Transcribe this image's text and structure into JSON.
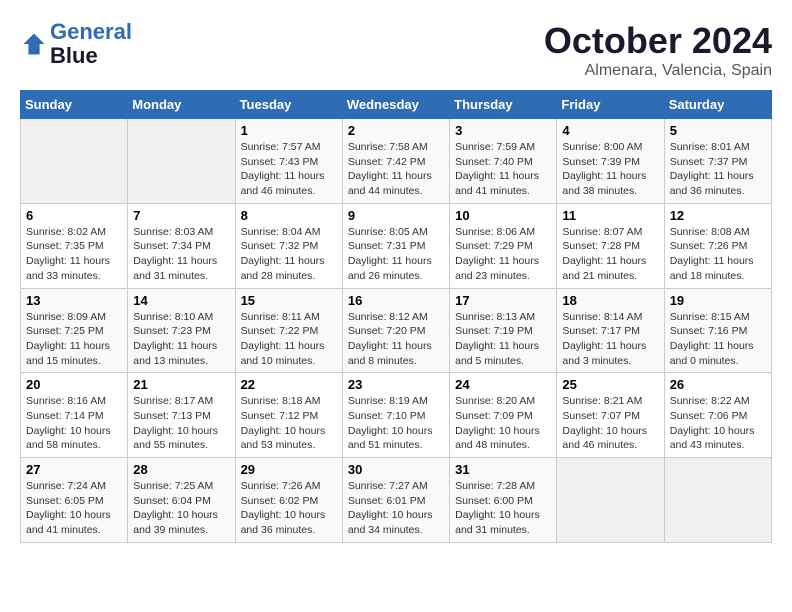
{
  "header": {
    "logo_line1": "General",
    "logo_line2": "Blue",
    "month": "October 2024",
    "location": "Almenara, Valencia, Spain"
  },
  "weekdays": [
    "Sunday",
    "Monday",
    "Tuesday",
    "Wednesday",
    "Thursday",
    "Friday",
    "Saturday"
  ],
  "weeks": [
    [
      {
        "day": "",
        "info": ""
      },
      {
        "day": "",
        "info": ""
      },
      {
        "day": "1",
        "info": "Sunrise: 7:57 AM\nSunset: 7:43 PM\nDaylight: 11 hours and 46 minutes."
      },
      {
        "day": "2",
        "info": "Sunrise: 7:58 AM\nSunset: 7:42 PM\nDaylight: 11 hours and 44 minutes."
      },
      {
        "day": "3",
        "info": "Sunrise: 7:59 AM\nSunset: 7:40 PM\nDaylight: 11 hours and 41 minutes."
      },
      {
        "day": "4",
        "info": "Sunrise: 8:00 AM\nSunset: 7:39 PM\nDaylight: 11 hours and 38 minutes."
      },
      {
        "day": "5",
        "info": "Sunrise: 8:01 AM\nSunset: 7:37 PM\nDaylight: 11 hours and 36 minutes."
      }
    ],
    [
      {
        "day": "6",
        "info": "Sunrise: 8:02 AM\nSunset: 7:35 PM\nDaylight: 11 hours and 33 minutes."
      },
      {
        "day": "7",
        "info": "Sunrise: 8:03 AM\nSunset: 7:34 PM\nDaylight: 11 hours and 31 minutes."
      },
      {
        "day": "8",
        "info": "Sunrise: 8:04 AM\nSunset: 7:32 PM\nDaylight: 11 hours and 28 minutes."
      },
      {
        "day": "9",
        "info": "Sunrise: 8:05 AM\nSunset: 7:31 PM\nDaylight: 11 hours and 26 minutes."
      },
      {
        "day": "10",
        "info": "Sunrise: 8:06 AM\nSunset: 7:29 PM\nDaylight: 11 hours and 23 minutes."
      },
      {
        "day": "11",
        "info": "Sunrise: 8:07 AM\nSunset: 7:28 PM\nDaylight: 11 hours and 21 minutes."
      },
      {
        "day": "12",
        "info": "Sunrise: 8:08 AM\nSunset: 7:26 PM\nDaylight: 11 hours and 18 minutes."
      }
    ],
    [
      {
        "day": "13",
        "info": "Sunrise: 8:09 AM\nSunset: 7:25 PM\nDaylight: 11 hours and 15 minutes."
      },
      {
        "day": "14",
        "info": "Sunrise: 8:10 AM\nSunset: 7:23 PM\nDaylight: 11 hours and 13 minutes."
      },
      {
        "day": "15",
        "info": "Sunrise: 8:11 AM\nSunset: 7:22 PM\nDaylight: 11 hours and 10 minutes."
      },
      {
        "day": "16",
        "info": "Sunrise: 8:12 AM\nSunset: 7:20 PM\nDaylight: 11 hours and 8 minutes."
      },
      {
        "day": "17",
        "info": "Sunrise: 8:13 AM\nSunset: 7:19 PM\nDaylight: 11 hours and 5 minutes."
      },
      {
        "day": "18",
        "info": "Sunrise: 8:14 AM\nSunset: 7:17 PM\nDaylight: 11 hours and 3 minutes."
      },
      {
        "day": "19",
        "info": "Sunrise: 8:15 AM\nSunset: 7:16 PM\nDaylight: 11 hours and 0 minutes."
      }
    ],
    [
      {
        "day": "20",
        "info": "Sunrise: 8:16 AM\nSunset: 7:14 PM\nDaylight: 10 hours and 58 minutes."
      },
      {
        "day": "21",
        "info": "Sunrise: 8:17 AM\nSunset: 7:13 PM\nDaylight: 10 hours and 55 minutes."
      },
      {
        "day": "22",
        "info": "Sunrise: 8:18 AM\nSunset: 7:12 PM\nDaylight: 10 hours and 53 minutes."
      },
      {
        "day": "23",
        "info": "Sunrise: 8:19 AM\nSunset: 7:10 PM\nDaylight: 10 hours and 51 minutes."
      },
      {
        "day": "24",
        "info": "Sunrise: 8:20 AM\nSunset: 7:09 PM\nDaylight: 10 hours and 48 minutes."
      },
      {
        "day": "25",
        "info": "Sunrise: 8:21 AM\nSunset: 7:07 PM\nDaylight: 10 hours and 46 minutes."
      },
      {
        "day": "26",
        "info": "Sunrise: 8:22 AM\nSunset: 7:06 PM\nDaylight: 10 hours and 43 minutes."
      }
    ],
    [
      {
        "day": "27",
        "info": "Sunrise: 7:24 AM\nSunset: 6:05 PM\nDaylight: 10 hours and 41 minutes."
      },
      {
        "day": "28",
        "info": "Sunrise: 7:25 AM\nSunset: 6:04 PM\nDaylight: 10 hours and 39 minutes."
      },
      {
        "day": "29",
        "info": "Sunrise: 7:26 AM\nSunset: 6:02 PM\nDaylight: 10 hours and 36 minutes."
      },
      {
        "day": "30",
        "info": "Sunrise: 7:27 AM\nSunset: 6:01 PM\nDaylight: 10 hours and 34 minutes."
      },
      {
        "day": "31",
        "info": "Sunrise: 7:28 AM\nSunset: 6:00 PM\nDaylight: 10 hours and 31 minutes."
      },
      {
        "day": "",
        "info": ""
      },
      {
        "day": "",
        "info": ""
      }
    ]
  ]
}
